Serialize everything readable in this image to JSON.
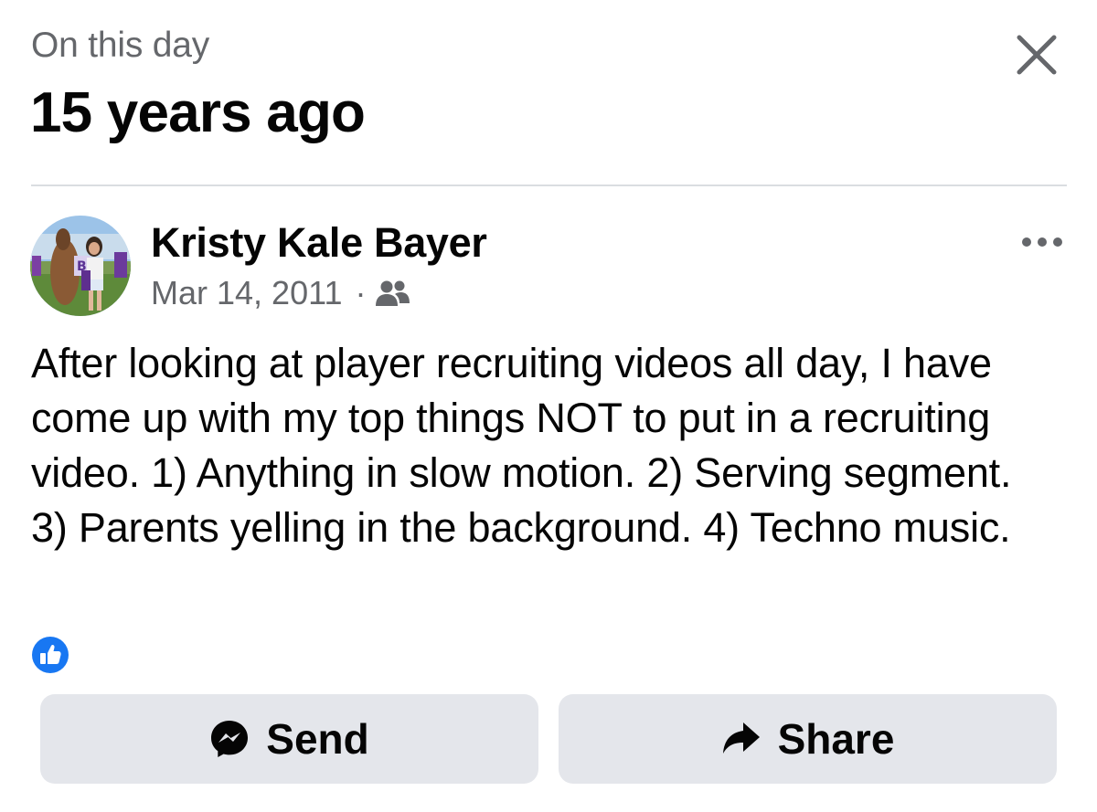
{
  "header": {
    "subtitle": "On this day",
    "title": "15 years ago",
    "close_icon": "close-icon"
  },
  "post": {
    "author": "Kristy Kale Bayer",
    "date": "Mar 14, 2011",
    "separator": "·",
    "audience_icon": "friends-icon",
    "more_icon": "more-options-icon",
    "text": "After looking at player recruiting videos all day, I have come up with my top things NOT to put in a recruiting video. 1) Anything in slow motion. 2) Serving segment. 3) Parents yelling in the background. 4) Techno music.",
    "reaction_icon": "like-reaction-icon"
  },
  "actions": {
    "send_label": "Send",
    "send_icon": "messenger-icon",
    "share_label": "Share",
    "share_icon": "share-arrow-icon"
  },
  "colors": {
    "primary_text": "#050505",
    "secondary_text": "#65676b",
    "button_bg": "#e4e6eb",
    "like_blue": "#1877f2",
    "divider": "#dadde1"
  }
}
